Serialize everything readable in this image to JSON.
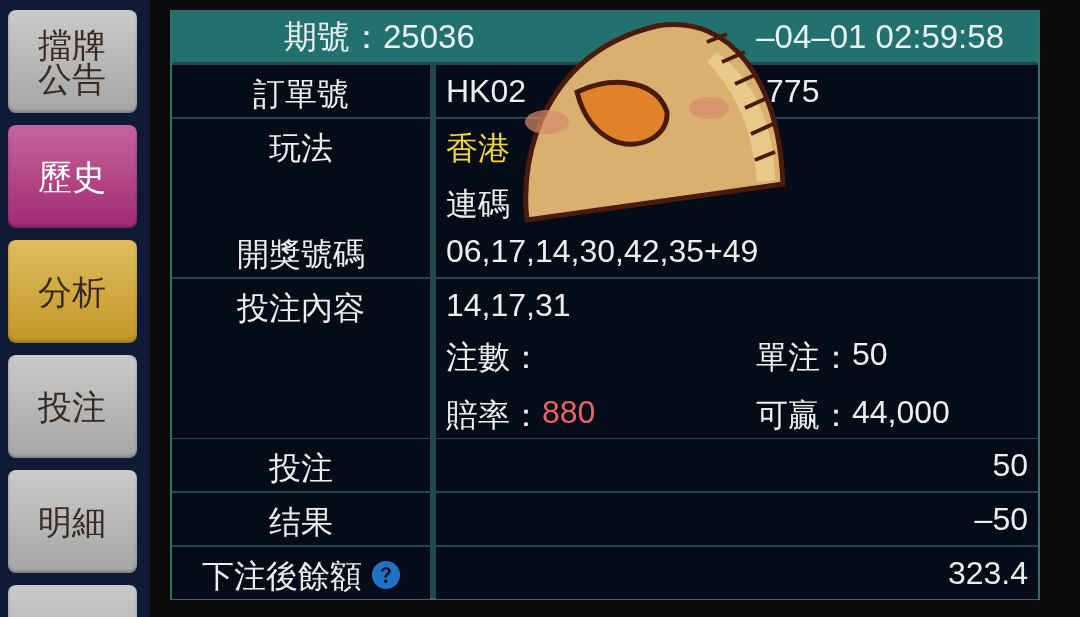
{
  "sidebar": {
    "buttons": [
      {
        "label": "擋牌公告",
        "color": "#b8b8b8"
      },
      {
        "label": "歷史",
        "color": "#b3307e"
      },
      {
        "label": "分析",
        "color": "#d6a72a"
      },
      {
        "label": "投注",
        "color": "#b8b8b8"
      },
      {
        "label": "明細",
        "color": "#b8b8b8"
      },
      {
        "color": "#b8b8b8"
      }
    ]
  },
  "header": {
    "period": "期號：25036",
    "time": "–04–01 02:59:58"
  },
  "rows": [
    {
      "kind": "text",
      "label": "訂單號",
      "parts": [
        "HK02",
        "775"
      ]
    },
    {
      "kind": "play",
      "label": "玩法",
      "lines": [
        [
          {
            "text": "香港",
            "highlight": true
          }
        ],
        [
          {
            "text": "連碼",
            "highlight": false
          }
        ]
      ]
    },
    {
      "kind": "text",
      "label": "開獎號碼",
      "parts": [
        "06,17,14,30,42,35+49"
      ]
    },
    {
      "kind": "bet",
      "label": "投注內容",
      "numbers": "14,17,31",
      "stats": [
        {
          "label": "注數："
        },
        {
          "label": "單注：",
          "value": "50",
          "highlight": false
        },
        {
          "label": "賠率：",
          "value": "880",
          "highlight": true
        },
        {
          "label": "可贏：",
          "value": "44,000",
          "highlight": false
        }
      ]
    },
    {
      "kind": "amount",
      "label": "投注",
      "value": "50"
    },
    {
      "kind": "amount",
      "label": "结果",
      "value": "–50"
    },
    {
      "kind": "amount",
      "label": "下注後餘額",
      "value": "323.4",
      "help": true
    }
  ]
}
